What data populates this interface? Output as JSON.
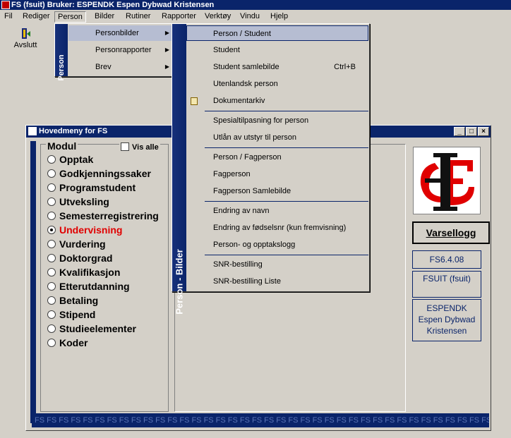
{
  "app": {
    "title": "FS (fsuit) Bruker: ESPENDK Espen Dybwad Kristensen"
  },
  "menubar": [
    "Fil",
    "Rediger",
    "Person",
    "Bilder",
    "Rutiner",
    "Rapporter",
    "Verktøy",
    "Vindu",
    "Hjelp"
  ],
  "toolbar": {
    "exit_label": "Avslutt"
  },
  "person_menu": {
    "band": "Person",
    "items": [
      "Personbilder",
      "Personrapporter",
      "Brev"
    ]
  },
  "personbilder_menu": {
    "band": "Person - Bilder",
    "items": [
      {
        "label": "Person / Student",
        "shortcut": ""
      },
      {
        "label": "Student",
        "shortcut": ""
      },
      {
        "label": "Student samlebilde",
        "shortcut": "Ctrl+B"
      },
      {
        "label": "Utenlandsk person",
        "shortcut": ""
      },
      {
        "label": "Dokumentarkiv",
        "shortcut": ""
      },
      {
        "label": "Spesialtilpasning for person",
        "shortcut": ""
      },
      {
        "label": "Utlån av utstyr til person",
        "shortcut": ""
      },
      {
        "label": "Person / Fagperson",
        "shortcut": ""
      },
      {
        "label": "Fagperson",
        "shortcut": ""
      },
      {
        "label": "Fagperson Samlebilde",
        "shortcut": ""
      },
      {
        "label": "Endring av navn",
        "shortcut": ""
      },
      {
        "label": "Endring av fødselsnr (kun fremvisning)",
        "shortcut": ""
      },
      {
        "label": "Person- og opptakslogg",
        "shortcut": ""
      },
      {
        "label": "SNR-bestilling",
        "shortcut": ""
      },
      {
        "label": "SNR-bestilling Liste",
        "shortcut": ""
      }
    ]
  },
  "mainwindow": {
    "title": "Hovedmeny for FS",
    "modul_label": "Modul",
    "vis_alle_label": "Vis alle",
    "modules": [
      "Opptak",
      "Godkjenningssaker",
      "Programstudent",
      "Utveksling",
      "Semesterregistrering",
      "Undervisning",
      "Vurdering",
      "Doktorgrad",
      "Kvalifikasjon",
      "Etterutdanning",
      "Betaling",
      "Stipend",
      "Studieelementer",
      "Koder"
    ],
    "selected_module": "Undervisning",
    "varsellogg_label": "Varsellogg",
    "version": "FS6.4.08",
    "db": "FSUIT (fsuit)",
    "user_line1": "ESPENDK",
    "user_line2": "Espen Dybwad Kristensen",
    "footer_text": "FS FS FS FS FS FS FS FS FS FS FS FS FS FS FS FS FS FS FS FS FS FS FS FS FS FS FS FS FS FS FS FS FS FS FS FS FS FS FS FS FS FS FS FS FS FS FS FS FS FS FS FS FS FS FS FS FS FS FS FS FS FS FS FS FS FS FS FS FS FS FS FS FS FS FS FS FS FS FS FS FS FS FS FS FS FS"
  },
  "colors": {
    "accent": "#0a246a",
    "selected_module": "#e00000",
    "menu_highlight": "#b6bdd2"
  }
}
